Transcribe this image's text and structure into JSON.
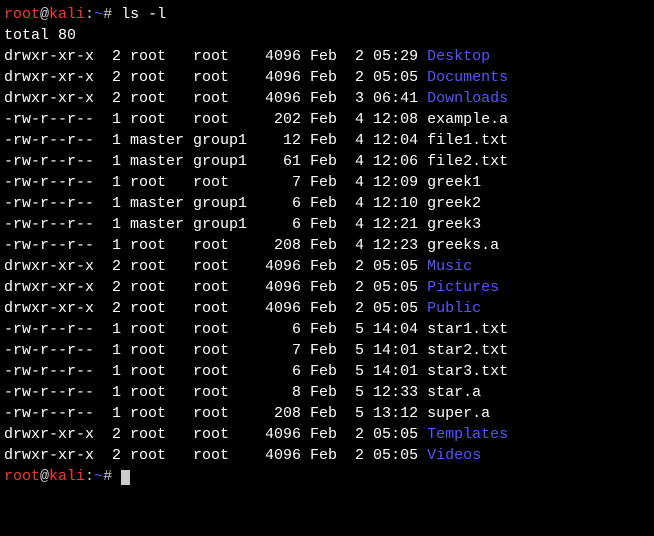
{
  "prompt": {
    "user": "root",
    "at": "@",
    "host": "kali",
    "colon": ":",
    "path": "~",
    "hash": "#"
  },
  "command": "ls -l",
  "total": "total 80",
  "entries": [
    {
      "perms": "drwxr-xr-x",
      "links": "2",
      "owner": "root",
      "group": "root",
      "size": "4096",
      "month": "Feb",
      "day": "2",
      "time": "05:29",
      "name": "Desktop",
      "is_dir": true
    },
    {
      "perms": "drwxr-xr-x",
      "links": "2",
      "owner": "root",
      "group": "root",
      "size": "4096",
      "month": "Feb",
      "day": "2",
      "time": "05:05",
      "name": "Documents",
      "is_dir": true
    },
    {
      "perms": "drwxr-xr-x",
      "links": "2",
      "owner": "root",
      "group": "root",
      "size": "4096",
      "month": "Feb",
      "day": "3",
      "time": "06:41",
      "name": "Downloads",
      "is_dir": true
    },
    {
      "perms": "-rw-r--r--",
      "links": "1",
      "owner": "root",
      "group": "root",
      "size": "202",
      "month": "Feb",
      "day": "4",
      "time": "12:08",
      "name": "example.a",
      "is_dir": false
    },
    {
      "perms": "-rw-r--r--",
      "links": "1",
      "owner": "master",
      "group": "group1",
      "size": "12",
      "month": "Feb",
      "day": "4",
      "time": "12:04",
      "name": "file1.txt",
      "is_dir": false
    },
    {
      "perms": "-rw-r--r--",
      "links": "1",
      "owner": "master",
      "group": "group1",
      "size": "61",
      "month": "Feb",
      "day": "4",
      "time": "12:06",
      "name": "file2.txt",
      "is_dir": false
    },
    {
      "perms": "-rw-r--r--",
      "links": "1",
      "owner": "root",
      "group": "root",
      "size": "7",
      "month": "Feb",
      "day": "4",
      "time": "12:09",
      "name": "greek1",
      "is_dir": false
    },
    {
      "perms": "-rw-r--r--",
      "links": "1",
      "owner": "master",
      "group": "group1",
      "size": "6",
      "month": "Feb",
      "day": "4",
      "time": "12:10",
      "name": "greek2",
      "is_dir": false
    },
    {
      "perms": "-rw-r--r--",
      "links": "1",
      "owner": "master",
      "group": "group1",
      "size": "6",
      "month": "Feb",
      "day": "4",
      "time": "12:21",
      "name": "greek3",
      "is_dir": false
    },
    {
      "perms": "-rw-r--r--",
      "links": "1",
      "owner": "root",
      "group": "root",
      "size": "208",
      "month": "Feb",
      "day": "4",
      "time": "12:23",
      "name": "greeks.a",
      "is_dir": false
    },
    {
      "perms": "drwxr-xr-x",
      "links": "2",
      "owner": "root",
      "group": "root",
      "size": "4096",
      "month": "Feb",
      "day": "2",
      "time": "05:05",
      "name": "Music",
      "is_dir": true
    },
    {
      "perms": "drwxr-xr-x",
      "links": "2",
      "owner": "root",
      "group": "root",
      "size": "4096",
      "month": "Feb",
      "day": "2",
      "time": "05:05",
      "name": "Pictures",
      "is_dir": true
    },
    {
      "perms": "drwxr-xr-x",
      "links": "2",
      "owner": "root",
      "group": "root",
      "size": "4096",
      "month": "Feb",
      "day": "2",
      "time": "05:05",
      "name": "Public",
      "is_dir": true
    },
    {
      "perms": "-rw-r--r--",
      "links": "1",
      "owner": "root",
      "group": "root",
      "size": "6",
      "month": "Feb",
      "day": "5",
      "time": "14:04",
      "name": "star1.txt",
      "is_dir": false
    },
    {
      "perms": "-rw-r--r--",
      "links": "1",
      "owner": "root",
      "group": "root",
      "size": "7",
      "month": "Feb",
      "day": "5",
      "time": "14:01",
      "name": "star2.txt",
      "is_dir": false
    },
    {
      "perms": "-rw-r--r--",
      "links": "1",
      "owner": "root",
      "group": "root",
      "size": "6",
      "month": "Feb",
      "day": "5",
      "time": "14:01",
      "name": "star3.txt",
      "is_dir": false
    },
    {
      "perms": "-rw-r--r--",
      "links": "1",
      "owner": "root",
      "group": "root",
      "size": "8",
      "month": "Feb",
      "day": "5",
      "time": "12:33",
      "name": "star.a",
      "is_dir": false
    },
    {
      "perms": "-rw-r--r--",
      "links": "1",
      "owner": "root",
      "group": "root",
      "size": "208",
      "month": "Feb",
      "day": "5",
      "time": "13:12",
      "name": "super.a",
      "is_dir": false
    },
    {
      "perms": "drwxr-xr-x",
      "links": "2",
      "owner": "root",
      "group": "root",
      "size": "4096",
      "month": "Feb",
      "day": "2",
      "time": "05:05",
      "name": "Templates",
      "is_dir": true
    },
    {
      "perms": "drwxr-xr-x",
      "links": "2",
      "owner": "root",
      "group": "root",
      "size": "4096",
      "month": "Feb",
      "day": "2",
      "time": "05:05",
      "name": "Videos",
      "is_dir": true
    }
  ]
}
